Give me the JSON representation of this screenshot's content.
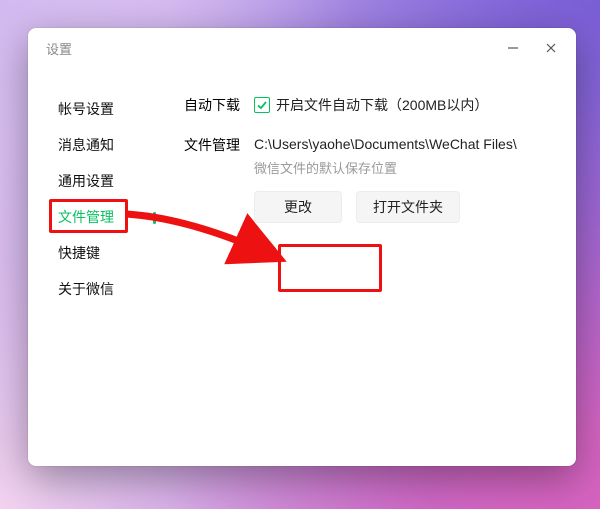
{
  "window": {
    "title": "设置"
  },
  "sidebar": {
    "items": [
      {
        "key": "account",
        "label": "帐号设置",
        "active": false
      },
      {
        "key": "notify",
        "label": "消息通知",
        "active": false
      },
      {
        "key": "general",
        "label": "通用设置",
        "active": false
      },
      {
        "key": "files",
        "label": "文件管理",
        "active": true
      },
      {
        "key": "shortcut",
        "label": "快捷键",
        "active": false
      },
      {
        "key": "about",
        "label": "关于微信",
        "active": false
      }
    ]
  },
  "content": {
    "autodownload": {
      "label": "自动下载",
      "checkbox_text": "开启文件自动下载（200MB以内）",
      "checked": true
    },
    "filemanage": {
      "label": "文件管理",
      "path": "C:\\Users\\yaohe\\Documents\\WeChat Files\\",
      "hint": "微信文件的默认保存位置",
      "change_label": "更改",
      "open_label": "打开文件夹"
    }
  },
  "annotation": {
    "highlight_nav_key": "files",
    "highlight_button": "change"
  }
}
